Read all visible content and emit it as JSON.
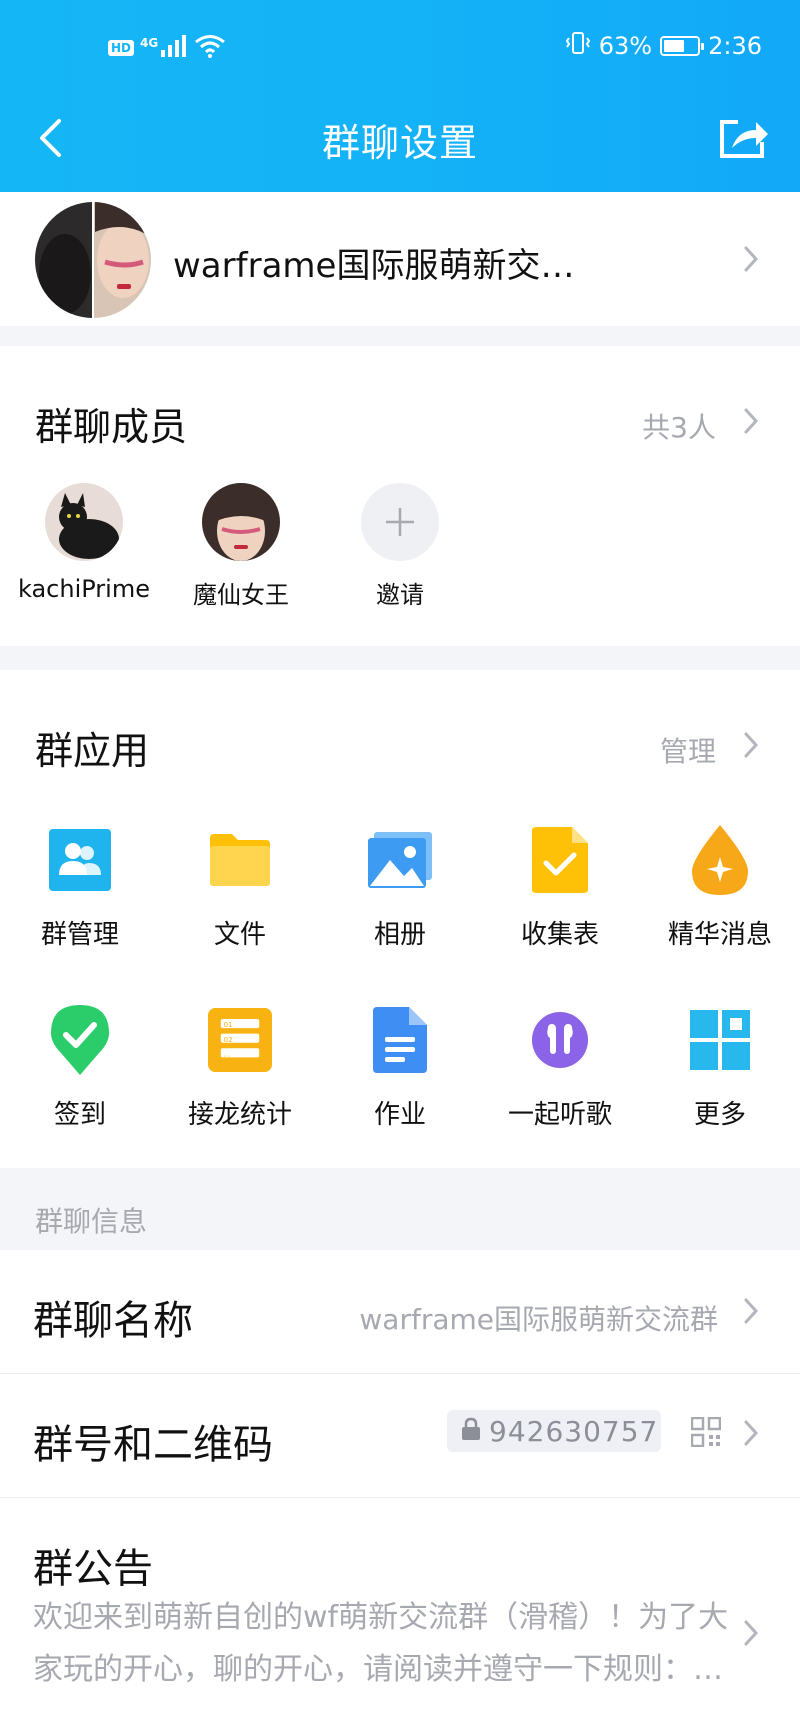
{
  "status_bar": {
    "hd": "HD",
    "network": "4G",
    "battery_percent": "63%",
    "battery_level": 0.63,
    "time": "2:36"
  },
  "header": {
    "title": "群聊设置",
    "back_icon": "chevron-left-icon",
    "share_icon": "share-icon"
  },
  "group": {
    "name": "warframe国际服萌新交…"
  },
  "members": {
    "title": "群聊成员",
    "count_label": "共3人",
    "list": [
      {
        "name": "kachiPrime"
      },
      {
        "name": "魔仙女王"
      },
      {
        "name": "邀请"
      }
    ]
  },
  "apps": {
    "title": "群应用",
    "manage_label": "管理",
    "items": [
      {
        "label": "群管理",
        "icon": "group-manage-icon",
        "color": "#1fb4ee"
      },
      {
        "label": "文件",
        "icon": "folder-icon",
        "color": "#ffc107"
      },
      {
        "label": "相册",
        "icon": "album-icon",
        "color": "#3d9bf2"
      },
      {
        "label": "收集表",
        "icon": "collect-form-icon",
        "color": "#ffc107"
      },
      {
        "label": "精华消息",
        "icon": "essence-icon",
        "color": "#f6a818"
      },
      {
        "label": "签到",
        "icon": "check-in-icon",
        "color": "#2bcc6a"
      },
      {
        "label": "接龙统计",
        "icon": "relay-list-icon",
        "color": "#f8b312"
      },
      {
        "label": "作业",
        "icon": "homework-icon",
        "color": "#3f8ef4"
      },
      {
        "label": "一起听歌",
        "icon": "earphones-icon",
        "color": "#8a63e8"
      },
      {
        "label": "更多",
        "icon": "grid-more-icon",
        "color": "#28b8ee"
      }
    ]
  },
  "info": {
    "section_label": "群聊信息",
    "name_label": "群聊名称",
    "name_value": "warframe国际服萌新交流群",
    "number_label": "群号和二维码",
    "number_value": "942630757",
    "notice_label": "群公告",
    "notice_text": "欢迎来到萌新自创的wf萌新交流群（滑稽）！为了大家玩的开心，聊的开心，请阅读并遵守一下规则：…"
  }
}
